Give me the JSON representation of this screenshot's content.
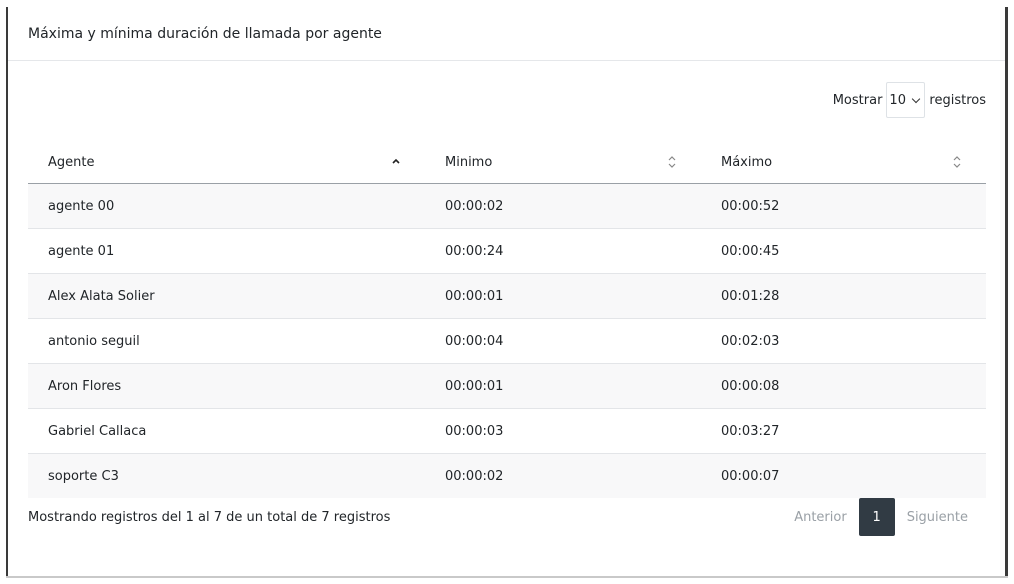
{
  "card": {
    "title": "Máxima y mínima duración de llamada por agente"
  },
  "length": {
    "prefix": "Mostrar",
    "selected": "10",
    "suffix": "registros"
  },
  "table": {
    "columns": [
      {
        "label": "Agente",
        "sort": "asc"
      },
      {
        "label": "Minimo",
        "sort": "none"
      },
      {
        "label": "Máximo",
        "sort": "none"
      }
    ],
    "rows": [
      {
        "agente": "agente 00",
        "minimo": "00:00:02",
        "maximo": "00:00:52"
      },
      {
        "agente": "agente 01",
        "minimo": "00:00:24",
        "maximo": "00:00:45"
      },
      {
        "agente": "Alex Alata Solier",
        "minimo": "00:00:01",
        "maximo": "00:01:28"
      },
      {
        "agente": "antonio seguil",
        "minimo": "00:00:04",
        "maximo": "00:02:03"
      },
      {
        "agente": "Aron Flores",
        "minimo": "00:00:01",
        "maximo": "00:00:08"
      },
      {
        "agente": "Gabriel Callaca",
        "minimo": "00:00:03",
        "maximo": "00:03:27"
      },
      {
        "agente": "soporte C3",
        "minimo": "00:00:02",
        "maximo": "00:00:07"
      }
    ]
  },
  "info": "Mostrando registros del 1 al 7 de un total de 7 registros",
  "pagination": {
    "previous": "Anterior",
    "current": "1",
    "next": "Siguiente"
  }
}
